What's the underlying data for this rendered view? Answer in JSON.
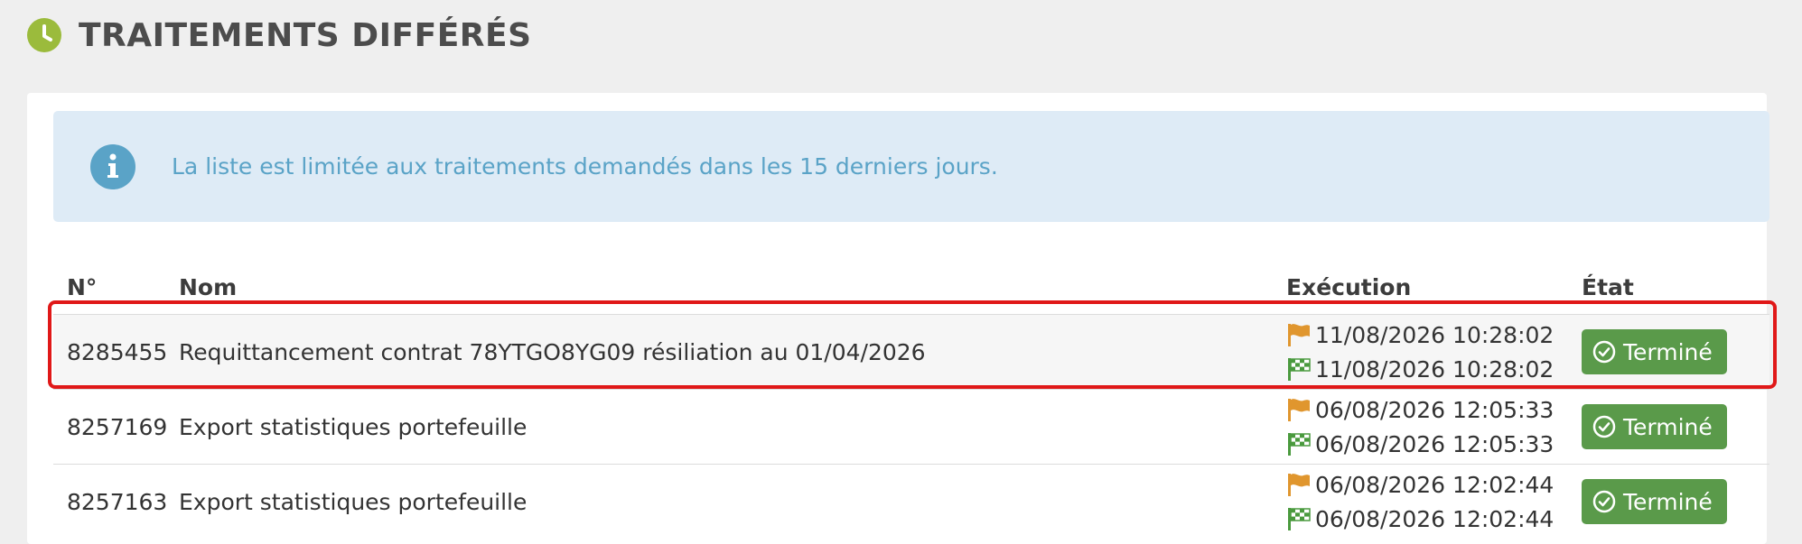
{
  "header": {
    "title": "TRAITEMENTS DIFFÉRÉS",
    "icon": "clock-icon",
    "icon_color": "#9bbb3c"
  },
  "alert": {
    "icon": "info-icon",
    "text": "La liste est limitée aux traitements demandés dans les 15 derniers jours.",
    "background": "#deebf6",
    "text_color": "#5aa3c7"
  },
  "table": {
    "columns": {
      "num": "N°",
      "name": "Nom",
      "exec": "Exécution",
      "etat": "État"
    },
    "rows": [
      {
        "num": "8285455",
        "name": "Requittancement contrat 78YTGO8YG09 résiliation au 01/04/2026",
        "start": "11/08/2026 10:28:02",
        "end": "11/08/2026 10:28:02",
        "status": "Terminé",
        "highlighted": true
      },
      {
        "num": "8257169",
        "name": "Export statistiques portefeuille",
        "start": "06/08/2026 12:05:33",
        "end": "06/08/2026 12:05:33",
        "status": "Terminé",
        "highlighted": false
      },
      {
        "num": "8257163",
        "name": "Export statistiques portefeuille",
        "start": "06/08/2026 12:02:44",
        "end": "06/08/2026 12:02:44",
        "status": "Terminé",
        "highlighted": false
      }
    ]
  },
  "colors": {
    "status_success": "#5a9a4a",
    "flag_start": "#e0962e",
    "flag_end": "#4a9a3e",
    "highlight_border": "#e01818"
  }
}
